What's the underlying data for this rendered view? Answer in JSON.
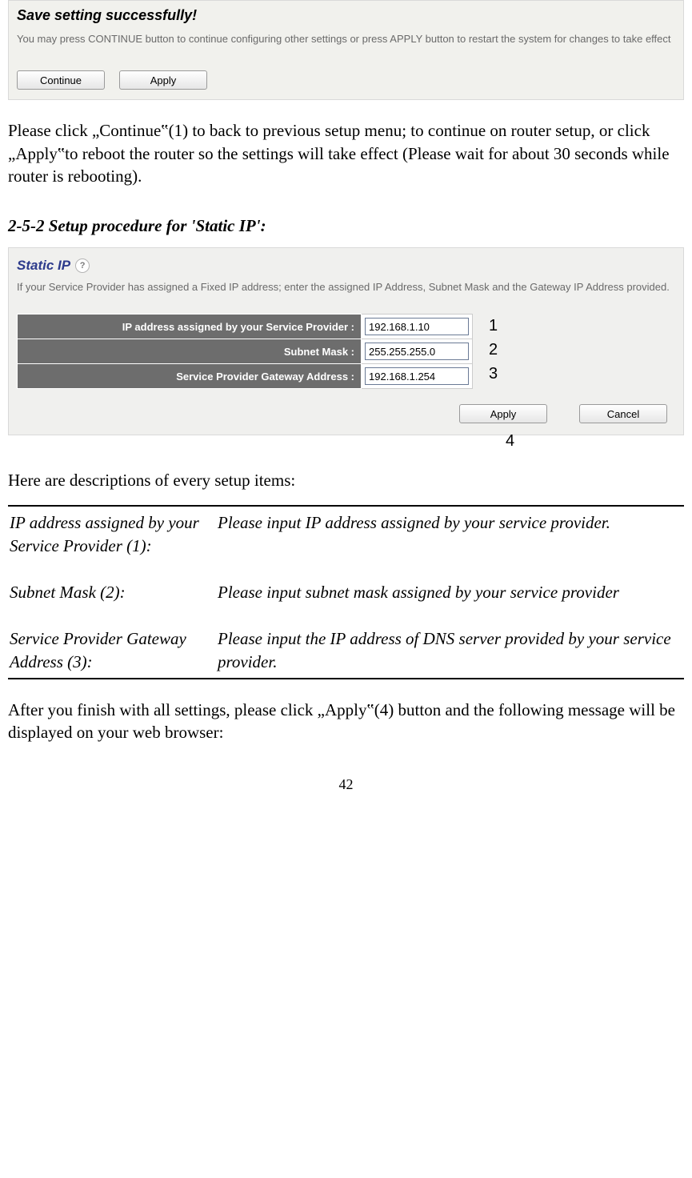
{
  "save_panel": {
    "title": "Save setting successfully!",
    "hint": "You may press CONTINUE button to continue configuring other settings or press APPLY button to restart the system for changes to take effect",
    "continue_btn": "Continue",
    "apply_btn": "Apply"
  },
  "body_text_1": "Please click „Continue‟(1) to back to previous setup menu; to continue on router setup, or click „Apply‟to reboot the router so the settings will take effect (Please wait for about 30 seconds while router is rebooting).",
  "heading_1": "2-5-2 Setup procedure for 'Static IP':",
  "static_panel": {
    "title": "Static IP",
    "help_glyph": "?",
    "hint": "If your Service Provider has assigned a Fixed IP address; enter the assigned IP Address, Subnet Mask and the Gateway IP Address provided.",
    "rows": [
      {
        "label": "IP address assigned by your Service Provider :",
        "value": "192.168.1.10",
        "badge": "1"
      },
      {
        "label": "Subnet Mask :",
        "value": "255.255.255.0",
        "badge": "2"
      },
      {
        "label": "Service Provider Gateway Address :",
        "value": "192.168.1.254",
        "badge": "3"
      }
    ],
    "apply_btn": "Apply",
    "cancel_btn": "Cancel",
    "badge_4": "4"
  },
  "desc_intro": "Here are descriptions of every setup items:",
  "desc_items": [
    {
      "label": "IP address assigned by your Service Provider (1):",
      "desc": "Please input IP address assigned by your service provider."
    },
    {
      "label": "Subnet Mask (2):",
      "desc": "Please input subnet mask assigned by your service provider"
    },
    {
      "label": "Service Provider Gateway Address (3):",
      "desc": "Please input the IP address of DNS server provided by your service provider."
    }
  ],
  "body_text_2": "After you finish with all settings, please click „Apply‟(4) button and the following message will be displayed on your web browser:",
  "page_number": "42"
}
